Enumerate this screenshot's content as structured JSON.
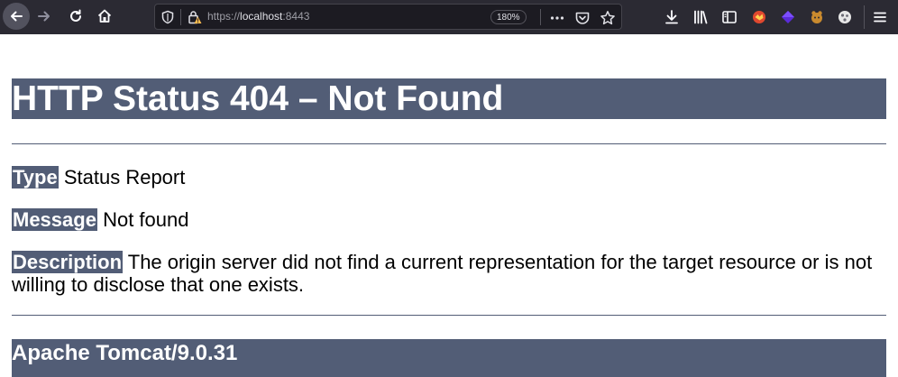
{
  "browser": {
    "url": {
      "scheme": "https://",
      "host": "localhost",
      "port": ":8443"
    },
    "zoom_level": "180%",
    "icons": {
      "back": "back-arrow-icon",
      "forward": "forward-arrow-icon",
      "reload": "reload-icon",
      "home": "home-icon",
      "tracking": "shield-icon",
      "security": "warning-lock-icon",
      "page_actions": "more-dots-icon",
      "pocket": "pocket-icon",
      "bookmark": "star-icon",
      "downloads": "download-icon",
      "library": "library-icon",
      "sidebar": "sidebar-icon",
      "menu": "hamburger-menu-icon"
    },
    "extensions": [
      {
        "name": "extension-icon-1",
        "color": "#e0482f"
      },
      {
        "name": "extension-icon-2",
        "color": "#5a2bd9"
      },
      {
        "name": "extension-icon-3",
        "color": "#c98a2e"
      },
      {
        "name": "extension-icon-4",
        "color": "#e8e8e8"
      }
    ]
  },
  "page": {
    "title": "HTTP Status 404 – Not Found",
    "type_label": "Type",
    "type_value": "Status Report",
    "message_label": "Message",
    "message_value": "Not found",
    "description_label": "Description",
    "description_value": "The origin server did not find a current representation for the target resource or is not willing to disclose that one exists.",
    "footer": "Apache Tomcat/9.0.31"
  },
  "colors": {
    "toolbar_bg": "#2b2a33",
    "urlbar_bg": "#1c1b22",
    "tomcat_header": "#525d76"
  }
}
